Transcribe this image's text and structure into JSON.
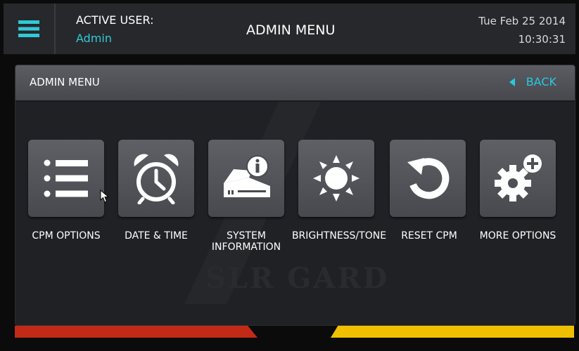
{
  "header": {
    "active_user_label": "ACTIVE USER:",
    "active_user_value": "Admin",
    "title": "ADMIN MENU",
    "date": "Tue Feb 25 2014",
    "time": "10:30:31"
  },
  "panel": {
    "title": "ADMIN MENU",
    "back_label": "BACK"
  },
  "tiles": [
    {
      "label_line1": "CPM OPTIONS",
      "label_line2": "",
      "icon": "list-icon"
    },
    {
      "label_line1": "DATE & TIME",
      "label_line2": "",
      "icon": "alarm-clock-icon"
    },
    {
      "label_line1": "SYSTEM",
      "label_line2": "INFORMATION",
      "icon": "system-info-icon"
    },
    {
      "label_line1": "BRIGHTNESS/TONE",
      "label_line2": "",
      "icon": "sun-icon"
    },
    {
      "label_line1": "RESET CPM",
      "label_line2": "",
      "icon": "reset-icon"
    },
    {
      "label_line1": "MORE OPTIONS",
      "label_line2": "",
      "icon": "gear-plus-icon"
    }
  ],
  "watermark": "SLR GARD",
  "colors": {
    "accent": "#2fc9d9",
    "stripe_red": "#c22a18",
    "stripe_yellow": "#f0c000"
  }
}
